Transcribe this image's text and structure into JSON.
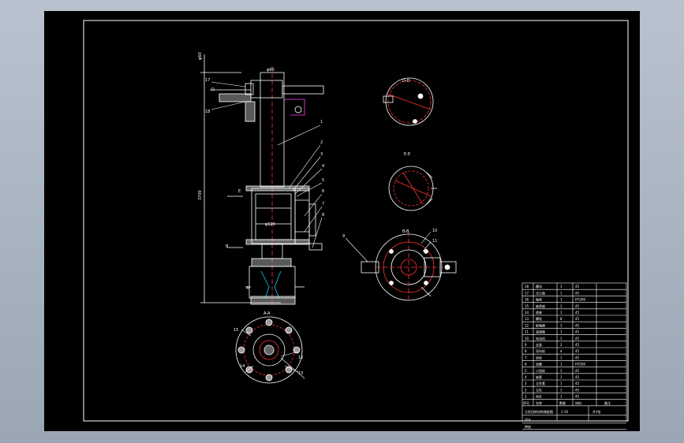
{
  "section_labels": {
    "aa": "A-A",
    "bb": "B-B",
    "dd": "D-D",
    "ee": "E-E"
  },
  "section_marks": {
    "a": "A",
    "d": "D",
    "e": "E",
    "b": "B"
  },
  "callouts": [
    "1",
    "2",
    "3",
    "4",
    "5",
    "6",
    "7",
    "8",
    "9",
    "10",
    "11",
    "12",
    "13",
    "14",
    "15",
    "16",
    "17",
    "18"
  ],
  "dimensions": {
    "top_width": "φ80",
    "inner": "φ120",
    "total_height": "3700",
    "top": "φ60"
  },
  "bom": {
    "rows": [
      {
        "no": "18",
        "name": "螺母",
        "qty": "1",
        "mat": "45"
      },
      {
        "no": "17",
        "name": "法兰盘",
        "qty": "1",
        "mat": "45"
      },
      {
        "no": "16",
        "name": "轴承",
        "qty": "1",
        "mat": "HT200"
      },
      {
        "no": "15",
        "name": "轴承座",
        "qty": "1",
        "mat": "45"
      },
      {
        "no": "14",
        "name": "底座",
        "qty": "1",
        "mat": "45"
      },
      {
        "no": "13",
        "name": "螺栓",
        "qty": "8",
        "mat": "45"
      },
      {
        "no": "12",
        "name": "联轴器",
        "qty": "1",
        "mat": "45"
      },
      {
        "no": "11",
        "name": "减速器",
        "qty": "1",
        "mat": "45"
      },
      {
        "no": "10",
        "name": "电动机",
        "qty": "1",
        "mat": "45"
      },
      {
        "no": "9",
        "name": "支架",
        "qty": "2",
        "mat": "45"
      },
      {
        "no": "8",
        "name": "导向轮",
        "qty": "4",
        "mat": "45"
      },
      {
        "no": "7",
        "name": "齿轮",
        "qty": "1",
        "mat": "45"
      },
      {
        "no": "6",
        "name": "齿圈",
        "qty": "1",
        "mat": "HT200"
      },
      {
        "no": "5",
        "name": "小齿轮",
        "qty": "1",
        "mat": "45"
      },
      {
        "no": "4",
        "name": "轴套",
        "qty": "1",
        "mat": "45"
      },
      {
        "no": "3",
        "name": "立柱套",
        "qty": "1",
        "mat": "45"
      },
      {
        "no": "2",
        "name": "立柱",
        "qty": "1",
        "mat": "45"
      },
      {
        "no": "1",
        "name": "丝杠",
        "qty": "1",
        "mat": "45"
      }
    ],
    "header": {
      "no": "序号",
      "name": "名称",
      "qty": "数量",
      "mat": "材料",
      "remark": "备注"
    },
    "title_block": {
      "drawing_title": "立柱回转机构装配图",
      "scale": "1:10",
      "sheet": "共1张",
      "designer": "设计",
      "checker": "审核",
      "school": "XX大学"
    }
  }
}
